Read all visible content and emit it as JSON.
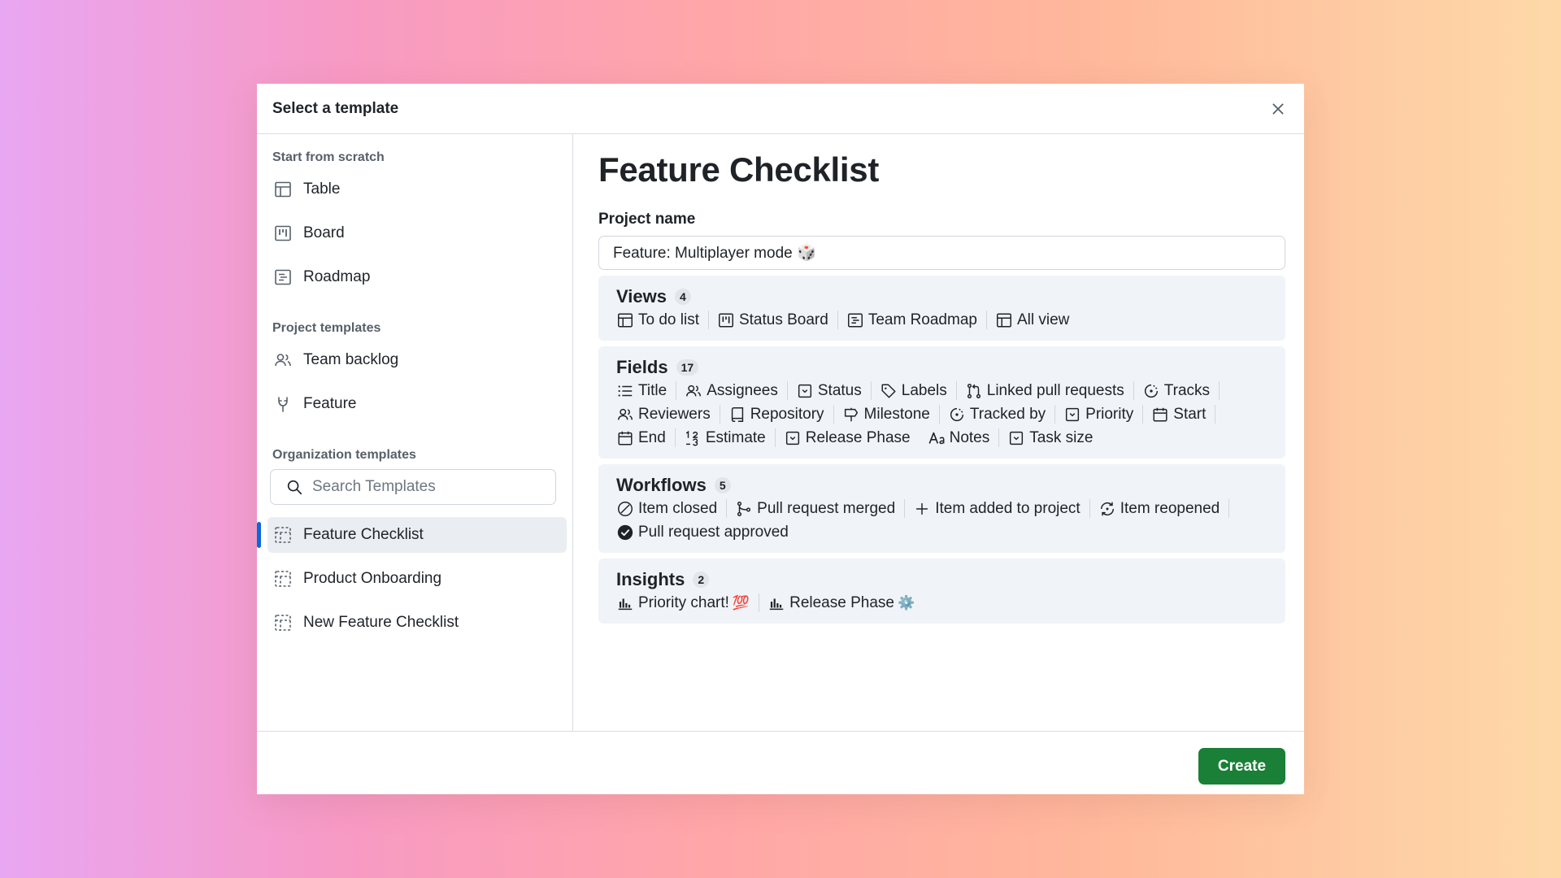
{
  "dialog": {
    "title": "Select a template"
  },
  "sidebar": {
    "scratch_title": "Start from scratch",
    "scratch_items": [
      {
        "label": "Table",
        "icon": "table-icon"
      },
      {
        "label": "Board",
        "icon": "board-icon"
      },
      {
        "label": "Roadmap",
        "icon": "roadmap-icon"
      }
    ],
    "project_title": "Project templates",
    "project_items": [
      {
        "label": "Team backlog",
        "icon": "people-icon"
      },
      {
        "label": "Feature",
        "icon": "feature-icon"
      }
    ],
    "org_title": "Organization templates",
    "search_placeholder": "Search Templates",
    "org_items": [
      {
        "label": "Feature Checklist",
        "icon": "template-icon",
        "selected": true
      },
      {
        "label": "Product Onboarding",
        "icon": "template-icon"
      },
      {
        "label": "New Feature Checklist",
        "icon": "template-icon"
      }
    ]
  },
  "main": {
    "title": "Feature Checklist",
    "project_name_label": "Project name",
    "project_name_value": "Feature: Multiplayer mode 🎲",
    "views": {
      "title": "Views",
      "count": "4",
      "items": [
        "To do list",
        "Status Board",
        "Team Roadmap",
        "All view"
      ]
    },
    "fields": {
      "title": "Fields",
      "count": "17",
      "items": [
        "Title",
        "Assignees",
        "Status",
        "Labels",
        "Linked pull requests",
        "Tracks",
        "Reviewers",
        "Repository",
        "Milestone",
        "Tracked by",
        "Priority",
        "Start",
        "End",
        "Estimate",
        "Release Phase",
        "Notes",
        "Task size"
      ]
    },
    "workflows": {
      "title": "Workflows",
      "count": "5",
      "items": [
        "Item closed",
        "Pull request merged",
        "Item added to project",
        "Item reopened",
        "Pull request approved"
      ]
    },
    "insights": {
      "title": "Insights",
      "count": "2",
      "items": [
        "Priority chart!",
        "Release Phase"
      ],
      "emojis": [
        "💯",
        "⚙️"
      ]
    }
  },
  "footer": {
    "create_label": "Create"
  },
  "colors": {
    "accent": "#0969da",
    "create": "#1a7f37",
    "section_bg": "#f0f4f8"
  }
}
